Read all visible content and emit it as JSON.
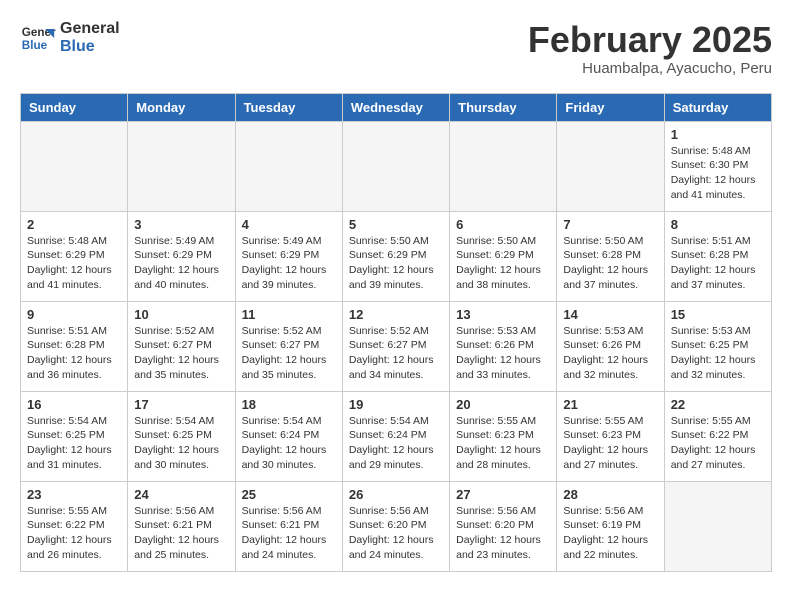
{
  "logo": {
    "line1": "General",
    "line2": "Blue"
  },
  "title": "February 2025",
  "subtitle": "Huambalpa, Ayacucho, Peru",
  "weekdays": [
    "Sunday",
    "Monday",
    "Tuesday",
    "Wednesday",
    "Thursday",
    "Friday",
    "Saturday"
  ],
  "weeks": [
    [
      {
        "day": "",
        "info": ""
      },
      {
        "day": "",
        "info": ""
      },
      {
        "day": "",
        "info": ""
      },
      {
        "day": "",
        "info": ""
      },
      {
        "day": "",
        "info": ""
      },
      {
        "day": "",
        "info": ""
      },
      {
        "day": "1",
        "info": "Sunrise: 5:48 AM\nSunset: 6:30 PM\nDaylight: 12 hours and 41 minutes."
      }
    ],
    [
      {
        "day": "2",
        "info": "Sunrise: 5:48 AM\nSunset: 6:29 PM\nDaylight: 12 hours and 41 minutes."
      },
      {
        "day": "3",
        "info": "Sunrise: 5:49 AM\nSunset: 6:29 PM\nDaylight: 12 hours and 40 minutes."
      },
      {
        "day": "4",
        "info": "Sunrise: 5:49 AM\nSunset: 6:29 PM\nDaylight: 12 hours and 39 minutes."
      },
      {
        "day": "5",
        "info": "Sunrise: 5:50 AM\nSunset: 6:29 PM\nDaylight: 12 hours and 39 minutes."
      },
      {
        "day": "6",
        "info": "Sunrise: 5:50 AM\nSunset: 6:29 PM\nDaylight: 12 hours and 38 minutes."
      },
      {
        "day": "7",
        "info": "Sunrise: 5:50 AM\nSunset: 6:28 PM\nDaylight: 12 hours and 37 minutes."
      },
      {
        "day": "8",
        "info": "Sunrise: 5:51 AM\nSunset: 6:28 PM\nDaylight: 12 hours and 37 minutes."
      }
    ],
    [
      {
        "day": "9",
        "info": "Sunrise: 5:51 AM\nSunset: 6:28 PM\nDaylight: 12 hours and 36 minutes."
      },
      {
        "day": "10",
        "info": "Sunrise: 5:52 AM\nSunset: 6:27 PM\nDaylight: 12 hours and 35 minutes."
      },
      {
        "day": "11",
        "info": "Sunrise: 5:52 AM\nSunset: 6:27 PM\nDaylight: 12 hours and 35 minutes."
      },
      {
        "day": "12",
        "info": "Sunrise: 5:52 AM\nSunset: 6:27 PM\nDaylight: 12 hours and 34 minutes."
      },
      {
        "day": "13",
        "info": "Sunrise: 5:53 AM\nSunset: 6:26 PM\nDaylight: 12 hours and 33 minutes."
      },
      {
        "day": "14",
        "info": "Sunrise: 5:53 AM\nSunset: 6:26 PM\nDaylight: 12 hours and 32 minutes."
      },
      {
        "day": "15",
        "info": "Sunrise: 5:53 AM\nSunset: 6:25 PM\nDaylight: 12 hours and 32 minutes."
      }
    ],
    [
      {
        "day": "16",
        "info": "Sunrise: 5:54 AM\nSunset: 6:25 PM\nDaylight: 12 hours and 31 minutes."
      },
      {
        "day": "17",
        "info": "Sunrise: 5:54 AM\nSunset: 6:25 PM\nDaylight: 12 hours and 30 minutes."
      },
      {
        "day": "18",
        "info": "Sunrise: 5:54 AM\nSunset: 6:24 PM\nDaylight: 12 hours and 30 minutes."
      },
      {
        "day": "19",
        "info": "Sunrise: 5:54 AM\nSunset: 6:24 PM\nDaylight: 12 hours and 29 minutes."
      },
      {
        "day": "20",
        "info": "Sunrise: 5:55 AM\nSunset: 6:23 PM\nDaylight: 12 hours and 28 minutes."
      },
      {
        "day": "21",
        "info": "Sunrise: 5:55 AM\nSunset: 6:23 PM\nDaylight: 12 hours and 27 minutes."
      },
      {
        "day": "22",
        "info": "Sunrise: 5:55 AM\nSunset: 6:22 PM\nDaylight: 12 hours and 27 minutes."
      }
    ],
    [
      {
        "day": "23",
        "info": "Sunrise: 5:55 AM\nSunset: 6:22 PM\nDaylight: 12 hours and 26 minutes."
      },
      {
        "day": "24",
        "info": "Sunrise: 5:56 AM\nSunset: 6:21 PM\nDaylight: 12 hours and 25 minutes."
      },
      {
        "day": "25",
        "info": "Sunrise: 5:56 AM\nSunset: 6:21 PM\nDaylight: 12 hours and 24 minutes."
      },
      {
        "day": "26",
        "info": "Sunrise: 5:56 AM\nSunset: 6:20 PM\nDaylight: 12 hours and 24 minutes."
      },
      {
        "day": "27",
        "info": "Sunrise: 5:56 AM\nSunset: 6:20 PM\nDaylight: 12 hours and 23 minutes."
      },
      {
        "day": "28",
        "info": "Sunrise: 5:56 AM\nSunset: 6:19 PM\nDaylight: 12 hours and 22 minutes."
      },
      {
        "day": "",
        "info": ""
      }
    ]
  ]
}
